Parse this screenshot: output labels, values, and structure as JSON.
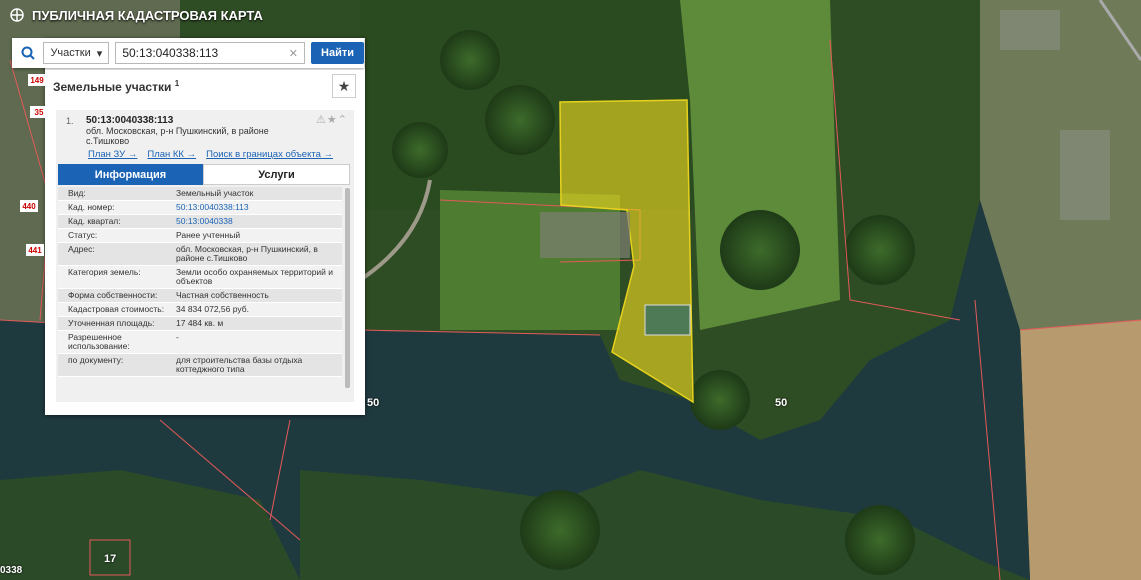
{
  "header": {
    "title": "ПУБЛИЧНАЯ КАДАСТРОВАЯ КАРТА"
  },
  "search": {
    "type_label": "Участки",
    "query": "50:13:040338:113",
    "find_label": "Найти"
  },
  "section": {
    "title": "Земельные участки",
    "count": "1"
  },
  "card": {
    "index": "1.",
    "cad_number": "50:13:0040338:113",
    "address": "обл. Московская, р-н Пушкинский, в районе с.Тишково",
    "links": [
      "План ЗУ →",
      "План КК →",
      "Поиск в границах объекта →"
    ],
    "tabs": [
      "Информация",
      "Услуги"
    ]
  },
  "info_rows": [
    {
      "k": "Вид:",
      "v": "Земельный участок",
      "link": false
    },
    {
      "k": "Кад. номер:",
      "v": "50:13:0040338:113",
      "link": true
    },
    {
      "k": "Кад. квартал:",
      "v": "50:13:0040338",
      "link": true
    },
    {
      "k": "Статус:",
      "v": "Ранее учтенный",
      "link": false
    },
    {
      "k": "Адрес:",
      "v": "обл. Московская, р-н Пушкинский, в районе с.Тишково",
      "link": false
    },
    {
      "k": "Категория земель:",
      "v": "Земли особо охраняемых территорий и объектов",
      "link": false
    },
    {
      "k": "Форма собственности:",
      "v": "Частная собственность",
      "link": false
    },
    {
      "k": "Кадастровая стоимость:",
      "v": "34 834 072,56 руб.",
      "link": false
    },
    {
      "k": "Уточненная площадь:",
      "v": "17 484 кв. м",
      "link": false
    },
    {
      "k": "Разрешенное использование:",
      "v": "-",
      "link": false
    },
    {
      "k": "по документу:",
      "v": "для строительства базы отдыха коттеджного типа",
      "link": false
    }
  ],
  "map_labels": {
    "l1": "50",
    "l2": "50",
    "l3": "17",
    "l4": "440",
    "l5": "441",
    "l6": "149",
    "l7": "35",
    "l8": "0338"
  },
  "colors": {
    "accent": "#1a63b5",
    "parcel_fill": "#e6d21e",
    "boundary": "#e35a5a"
  }
}
